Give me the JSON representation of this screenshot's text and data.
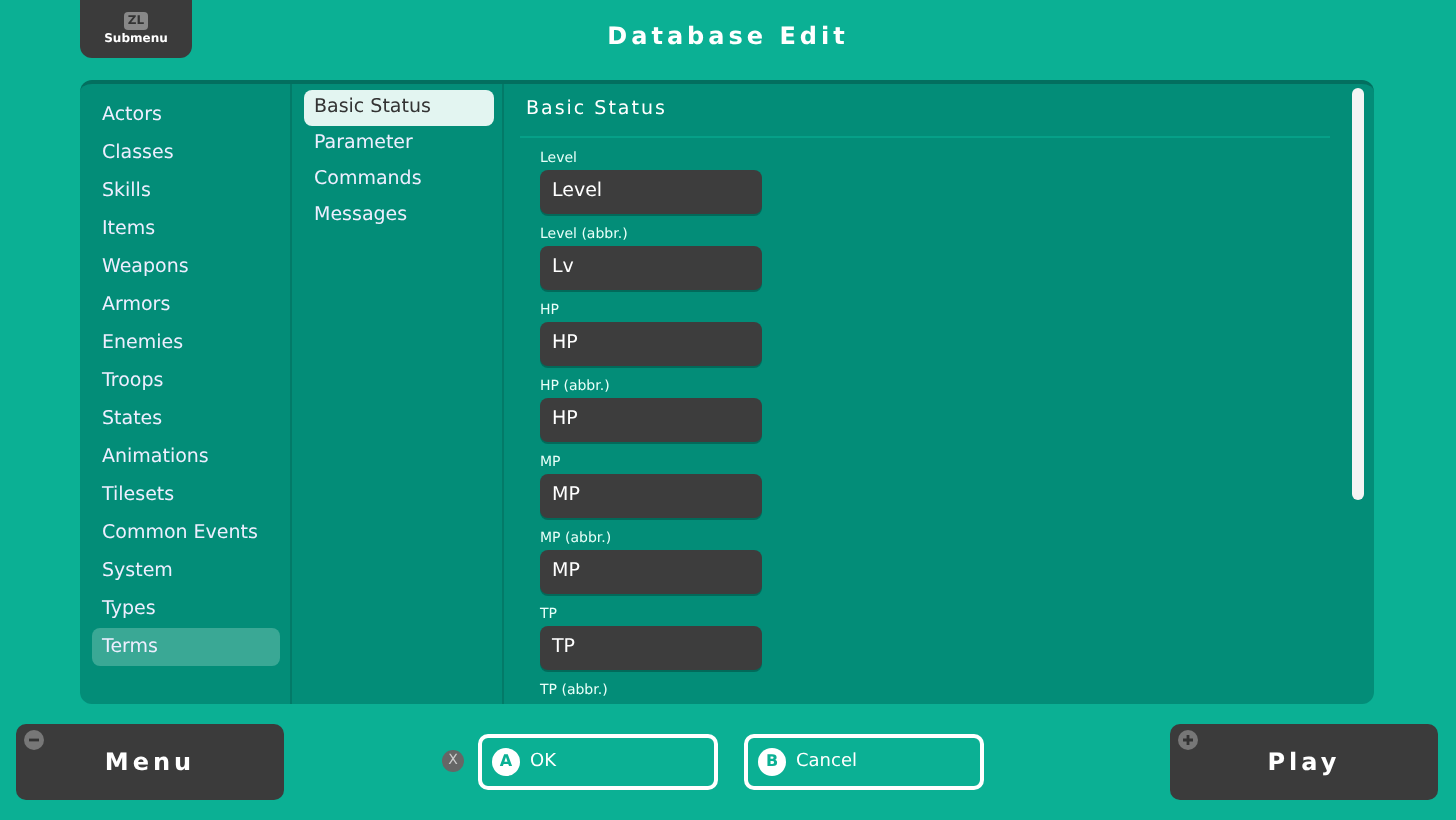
{
  "submenu_button": {
    "key": "ZL",
    "label": "Submenu"
  },
  "window": {
    "title": "Database Edit"
  },
  "categories": [
    {
      "label": "Actors",
      "selected": false
    },
    {
      "label": "Classes",
      "selected": false
    },
    {
      "label": "Skills",
      "selected": false
    },
    {
      "label": "Items",
      "selected": false
    },
    {
      "label": "Weapons",
      "selected": false
    },
    {
      "label": "Armors",
      "selected": false
    },
    {
      "label": "Enemies",
      "selected": false
    },
    {
      "label": "Troops",
      "selected": false
    },
    {
      "label": "States",
      "selected": false
    },
    {
      "label": "Animations",
      "selected": false
    },
    {
      "label": "Tilesets",
      "selected": false
    },
    {
      "label": "Common Events",
      "selected": false
    },
    {
      "label": "System",
      "selected": false
    },
    {
      "label": "Types",
      "selected": false
    },
    {
      "label": "Terms",
      "selected": true
    }
  ],
  "subcategories": [
    {
      "label": "Basic Status",
      "selected": true
    },
    {
      "label": "Parameter",
      "selected": false
    },
    {
      "label": "Commands",
      "selected": false
    },
    {
      "label": "Messages",
      "selected": false
    }
  ],
  "editor": {
    "heading": "Basic Status",
    "fields": [
      {
        "label": "Level",
        "value": "Level"
      },
      {
        "label": "Level (abbr.)",
        "value": "Lv"
      },
      {
        "label": "HP",
        "value": "HP"
      },
      {
        "label": "HP (abbr.)",
        "value": "HP"
      },
      {
        "label": "MP",
        "value": "MP"
      },
      {
        "label": "MP (abbr.)",
        "value": "MP"
      },
      {
        "label": "TP",
        "value": "TP"
      },
      {
        "label": "TP (abbr.)"
      }
    ]
  },
  "footer": {
    "menu_button": "Menu",
    "clear_key": "X",
    "ok_button": {
      "key": "A",
      "label": "OK"
    },
    "cancel_button": {
      "key": "B",
      "label": "Cancel"
    },
    "play_button": "Play"
  }
}
